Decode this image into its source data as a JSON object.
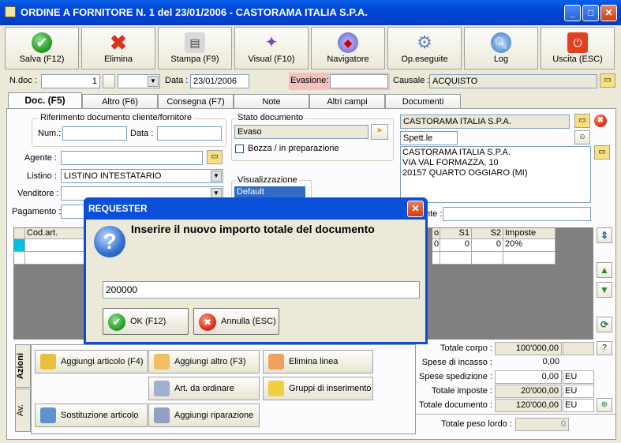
{
  "window": {
    "title": "ORDINE A FORNITORE N. 1   del 23/01/2006 - CASTORAMA ITALIA S.P.A."
  },
  "toolbar": [
    {
      "label": "Salva (F12)",
      "icon": "check-icon"
    },
    {
      "label": "Elimina",
      "icon": "delete-icon"
    },
    {
      "label": "Stampa (F9)",
      "icon": "printer-icon"
    },
    {
      "label": "Visual (F10)",
      "icon": "magic-wand-icon"
    },
    {
      "label": "Navigatore",
      "icon": "compass-icon"
    },
    {
      "label": "Op.eseguite",
      "icon": "gear-icon"
    },
    {
      "label": "Log",
      "icon": "magnifier-icon"
    },
    {
      "label": "Uscita (ESC)",
      "icon": "power-icon"
    }
  ],
  "header": {
    "ndoc_label": "N.doc :",
    "ndoc_value": "1",
    "data_label": "Data :",
    "data_value": "23/01/2006",
    "evasione_label": "Evasione:",
    "evasione_value": "",
    "causale_label": "Causale :",
    "causale_value": "ACQUISTO"
  },
  "tabs": [
    "Doc. (F5)",
    "Altro (F6)",
    "Consegna (F7)",
    "Note",
    "Altri campi",
    "Documenti"
  ],
  "doc": {
    "rif_title": "Riferimento documento cliente/fornitore",
    "num_label": "Num.:",
    "data_label": "Data :",
    "agente_label": "Agente :",
    "listino_label": "Listino :",
    "listino_value": "LISTINO INTESTATARIO",
    "venditore_label": "Venditore :",
    "pagamento_label": "Pagamento :",
    "stato_title": "Stato documento",
    "stato_value": "Evaso",
    "bozza_label": "Bozza / in preparazione",
    "visual_title": "Visualizzazione",
    "visual_value": "Default",
    "cliente_name": "CASTORAMA ITALIA S.P.A.",
    "spett": "Spett.le",
    "address_lines": [
      "CASTORAMA ITALIA S.P.A.",
      "VIA VAL FORMAZZA, 10",
      "20157 QUARTO OGGIARO (MI)"
    ],
    "nte_label": "nte :"
  },
  "grid": {
    "headers": [
      "Cod.art.",
      "o",
      "S1",
      "S2",
      "Imposte"
    ],
    "row": [
      "",
      "0",
      "0",
      "0",
      "20%"
    ]
  },
  "actions": {
    "vtab1": "Azioni",
    "vtab2": "Av.",
    "buttons": [
      {
        "label": "Aggiungi articolo (F4)",
        "name": "add-article-button"
      },
      {
        "label": "Aggiungi altro (F3)",
        "name": "add-other-button"
      },
      {
        "label": "Elimina linea",
        "name": "delete-line-button"
      },
      {
        "label": "Art. da ordinare",
        "name": "articles-to-order-button"
      },
      {
        "label": "Gruppi di inserimento",
        "name": "insert-groups-button"
      },
      {
        "label": "Sostituzione articolo",
        "name": "replace-article-button"
      },
      {
        "label": "Aggiungi riparazione",
        "name": "add-repair-button"
      }
    ]
  },
  "totals": {
    "rows": [
      {
        "label": "Totale corpo :",
        "value": "100'000,00",
        "cur": ""
      },
      {
        "label": "Spese di incasso :",
        "value": "0,00",
        "cur": ""
      },
      {
        "label": "Spese spedizione :",
        "value": "0,00",
        "cur": "EU"
      },
      {
        "label": "Totale imposte :",
        "value": "20'000,00",
        "cur": "EU"
      },
      {
        "label": "Totale documento :",
        "value": "120'000,00",
        "cur": "EU"
      }
    ],
    "help": "?",
    "peso_label": "Totale peso lordo :",
    "peso_value": "0"
  },
  "dialog": {
    "title": "REQUESTER",
    "message": "Inserire il nuovo importo totale del documento",
    "input_value": "200000",
    "ok_label": "OK (F12)",
    "cancel_label": "Annulla (ESC)"
  }
}
